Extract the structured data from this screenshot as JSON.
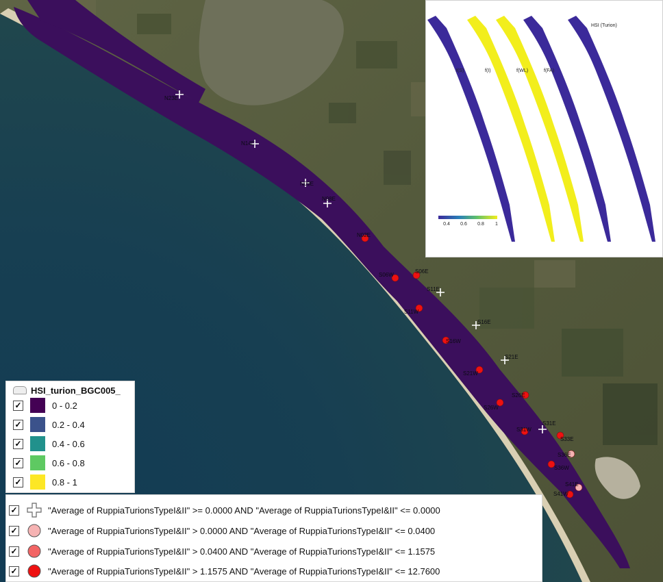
{
  "map": {
    "colors": {
      "sea": "#17384a",
      "land": "#5a5a3f",
      "lagoon_polygon": "#3b0f5c",
      "lake": "#6e705a",
      "beach": "#d9cfb3"
    },
    "sites": [
      {
        "label": "N23E",
        "symbol": "zero"
      },
      {
        "label": "N14E",
        "symbol": "zero"
      },
      {
        "label": "N09E",
        "symbol": "zero"
      },
      {
        "label": "N08E",
        "symbol": "zero"
      },
      {
        "label": "N02E",
        "symbol": "high"
      },
      {
        "label": "S06W",
        "symbol": "high"
      },
      {
        "label": "S06E",
        "symbol": "high"
      },
      {
        "label": "S11E",
        "symbol": "zero"
      },
      {
        "label": "S11W",
        "symbol": "high"
      },
      {
        "label": "S16E",
        "symbol": "zero"
      },
      {
        "label": "S16W",
        "symbol": "high"
      },
      {
        "label": "S21E",
        "symbol": "zero"
      },
      {
        "label": "S21W",
        "symbol": "high"
      },
      {
        "label": "S26E",
        "symbol": "high"
      },
      {
        "label": "S26W",
        "symbol": "high"
      },
      {
        "label": "S31W",
        "symbol": "high"
      },
      {
        "label": "S31E",
        "symbol": "zero"
      },
      {
        "label": "S33E",
        "symbol": "high"
      },
      {
        "label": "S36E",
        "symbol": "low"
      },
      {
        "label": "S36W",
        "symbol": "high"
      },
      {
        "label": "S41E",
        "symbol": "low"
      },
      {
        "label": "S41W",
        "symbol": "high"
      }
    ]
  },
  "inset": {
    "panel_labels": [
      "f(S)",
      "f(I)",
      "f(WL)",
      "f(FA)",
      "HSI (Turion)"
    ],
    "colorbar_ticks": [
      "0.4",
      "0.6",
      "0.8",
      "1"
    ],
    "colors": {
      "low": "#3b2a9a",
      "high": "#f2ee1c"
    }
  },
  "legend_hsi": {
    "title": "HSI_turion_BGC005_",
    "items": [
      {
        "label": "0 - 0.2",
        "color": "#440154"
      },
      {
        "label": "0.2 - 0.4",
        "color": "#3b528b"
      },
      {
        "label": "0.4 - 0.6",
        "color": "#21918c"
      },
      {
        "label": "0.6 - 0.8",
        "color": "#5ec962"
      },
      {
        "label": "0.8 - 1",
        "color": "#fde725"
      }
    ]
  },
  "legend_points": {
    "items": [
      {
        "symbol": "cross-icon",
        "label": "\"Average of RuppiaTurionsTypeI&II\" >= 0.0000 AND \"Average of RuppiaTurionsTypeI&II\" <= 0.0000"
      },
      {
        "symbol": "circle-pale-icon",
        "color": "#f6b3b3",
        "label": "\"Average of RuppiaTurionsTypeI&II\" > 0.0000 AND \"Average of RuppiaTurionsTypeI&II\" <= 0.0400"
      },
      {
        "symbol": "circle-mid-icon",
        "color": "#f26464",
        "label": "\"Average of RuppiaTurionsTypeI&II\" > 0.0400 AND \"Average of RuppiaTurionsTypeI&II\" <= 1.1575"
      },
      {
        "symbol": "circle-red-icon",
        "color": "#ee1111",
        "label": "\"Average of RuppiaTurionsTypeI&II\" > 1.1575 AND \"Average of RuppiaTurionsTypeI&II\" <= 12.7600"
      }
    ]
  }
}
